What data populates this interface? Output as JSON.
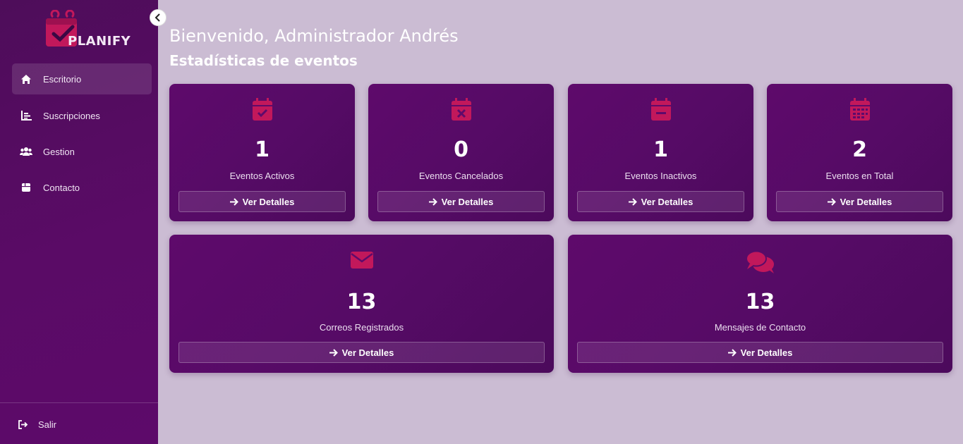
{
  "app": {
    "logo_text": "PLANIFY"
  },
  "sidebar": {
    "items": [
      {
        "label": "Escritorio",
        "icon": "home-icon",
        "active": true
      },
      {
        "label": "Suscripciones",
        "icon": "chart-icon"
      },
      {
        "label": "Gestion",
        "icon": "users-icon"
      },
      {
        "label": "Contacto",
        "icon": "box-icon"
      }
    ],
    "logout_label": "Salir"
  },
  "header": {
    "welcome": "Bienvenido, Administrador Andrés",
    "subtitle": "Estadísticas de eventos"
  },
  "cards": [
    {
      "value": "1",
      "label": "Eventos Activos",
      "button": "Ver Detalles",
      "icon": "calendar-check-icon"
    },
    {
      "value": "0",
      "label": "Eventos Cancelados",
      "button": "Ver Detalles",
      "icon": "calendar-x-icon"
    },
    {
      "value": "1",
      "label": "Eventos Inactivos",
      "button": "Ver Detalles",
      "icon": "calendar-minus-icon"
    },
    {
      "value": "2",
      "label": "Eventos en Total",
      "button": "Ver Detalles",
      "icon": "calendar-grid-icon"
    },
    {
      "value": "13",
      "label": "Correos Registrados",
      "button": "Ver Detalles",
      "icon": "envelope-icon"
    },
    {
      "value": "13",
      "label": "Mensajes de Contacto",
      "button": "Ver Detalles",
      "icon": "comments-icon"
    }
  ],
  "colors": {
    "accent": "#c2185b",
    "sidebar": "#560b66",
    "background": "#cbbcd3"
  }
}
